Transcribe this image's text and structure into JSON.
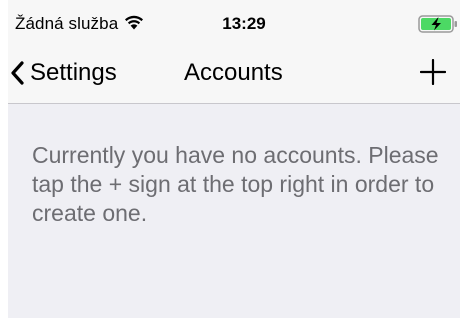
{
  "status_bar": {
    "carrier": "Žádná služba",
    "time": "13:29",
    "icons": [
      "wifi-icon",
      "battery-charging-icon"
    ],
    "battery_color": "#4cd964"
  },
  "nav_bar": {
    "back_label": "Settings",
    "title": "Accounts",
    "add_icon": "plus-icon"
  },
  "content": {
    "empty_message": "Currently you have no accounts. Please tap the + sign at the top right in order to create one."
  },
  "colors": {
    "bar_background": "#f7f7f7",
    "content_background": "#efeff4",
    "message_text": "#6d6d72"
  }
}
